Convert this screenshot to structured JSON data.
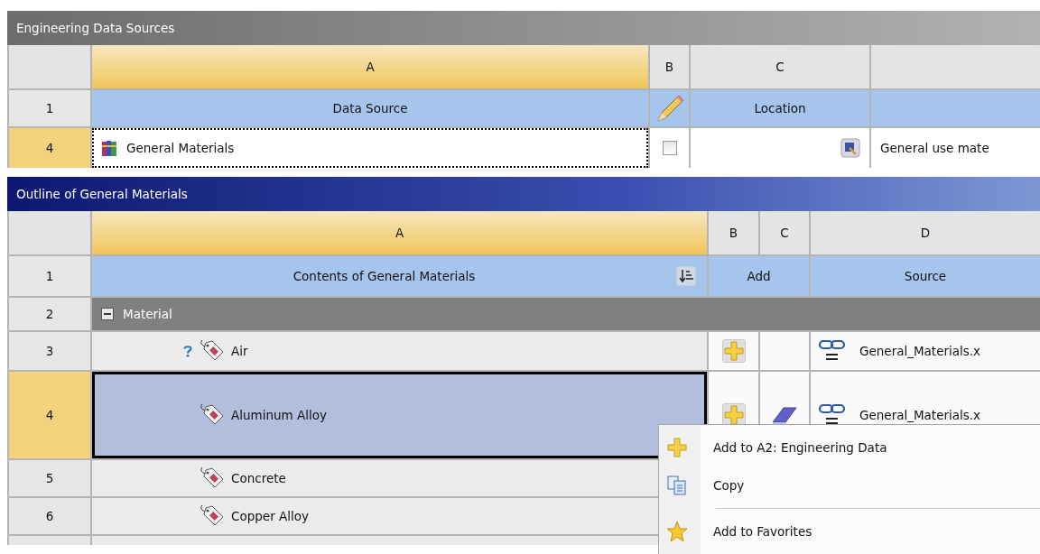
{
  "data_sources": {
    "title": "Engineering Data Sources",
    "column_letters": [
      "A",
      "B",
      "C"
    ],
    "header": {
      "number": "1",
      "data_source": "Data Source",
      "location": "Location"
    },
    "rows": [
      {
        "number": "4",
        "name": "General Materials",
        "checked": false,
        "description": "General use mate",
        "selected": true
      }
    ]
  },
  "outline": {
    "title": "Outline of General Materials",
    "column_letters": [
      "A",
      "B",
      "C",
      "D"
    ],
    "header": {
      "number": "1",
      "contents": "Contents of General Materials",
      "add": "Add",
      "source": "Source"
    },
    "group": {
      "number": "2",
      "label": "Material",
      "expanded": true
    },
    "rows": [
      {
        "number": "3",
        "name": "Air",
        "selected": false,
        "help": true,
        "add_button": true,
        "in_project": false,
        "source": "General_Materials.x"
      },
      {
        "number": "4",
        "name": "Aluminum Alloy",
        "selected": true,
        "help": false,
        "add_button": true,
        "in_project": true,
        "source": "General_Materials.x"
      },
      {
        "number": "5",
        "name": "Concrete",
        "selected": false,
        "help": false
      },
      {
        "number": "6",
        "name": "Copper Alloy",
        "selected": false,
        "help": false
      }
    ]
  },
  "context_menu": {
    "items": [
      {
        "kind": "add",
        "label": "Add to A2: Engineering Data"
      },
      {
        "kind": "copy",
        "label": "Copy"
      },
      {
        "kind": "separator"
      },
      {
        "kind": "favorite",
        "label": "Add to Favorites"
      }
    ]
  }
}
